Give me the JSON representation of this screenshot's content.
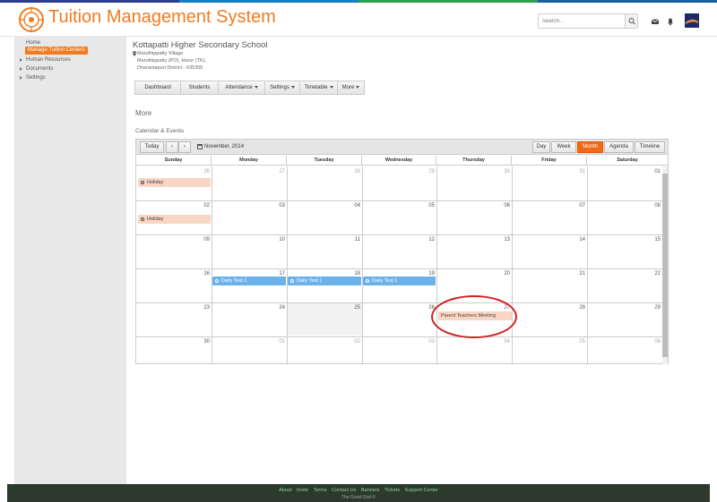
{
  "app": {
    "title": "Tuition Management System",
    "accent": "#f07b22"
  },
  "header": {
    "search_placeholder": "Search..."
  },
  "sidebar": {
    "items": [
      {
        "label": "Home"
      },
      {
        "label": "Manage Tuition  Centers"
      },
      {
        "label": "Human Resources"
      },
      {
        "label": "Documents"
      },
      {
        "label": "Settings"
      }
    ]
  },
  "school": {
    "name": "Kottapatti Higher Secondary School",
    "address": [
      "Maruthippatty Village",
      "Maruthippatty (PO), Harur (TK),",
      "Dharamapuri District - 635305"
    ]
  },
  "nav": [
    {
      "label": "Dashboard"
    },
    {
      "label": "Students"
    },
    {
      "label": "Attendance"
    },
    {
      "label": "Settings"
    },
    {
      "label": "Timetable"
    },
    {
      "label": "More"
    }
  ],
  "page": {
    "heading": "More",
    "section": "Calendar & Events"
  },
  "calendar": {
    "today_label": "Today",
    "month_label": "November, 2014",
    "views": [
      "Day",
      "Week",
      "Month",
      "Agenda",
      "Timeline"
    ],
    "active_view": "Month",
    "weekdays": [
      "Sunday",
      "Monday",
      "Tuesday",
      "Wednesday",
      "Thursday",
      "Friday",
      "Saturday"
    ],
    "weeks": [
      [
        "26",
        "27",
        "28",
        "29",
        "30",
        "31",
        "01"
      ],
      [
        "02",
        "03",
        "04",
        "05",
        "06",
        "07",
        "08"
      ],
      [
        "09",
        "10",
        "11",
        "12",
        "13",
        "14",
        "15"
      ],
      [
        "16",
        "17",
        "18",
        "19",
        "20",
        "21",
        "22"
      ],
      [
        "23",
        "24",
        "25",
        "26",
        "27",
        "28",
        "29"
      ],
      [
        "30",
        "01",
        "02",
        "03",
        "04",
        "05",
        "06"
      ]
    ],
    "events": {
      "holiday": "Holiday",
      "daily_test": "Daily Test 1",
      "ptm": "Parent Teachers Meeting"
    }
  },
  "footer": {
    "links": [
      "About",
      "Invite",
      "Terms",
      "Contact Us",
      "Banners",
      "Tickets",
      "Support Center"
    ],
    "copyright": "The Good Grid ©"
  }
}
